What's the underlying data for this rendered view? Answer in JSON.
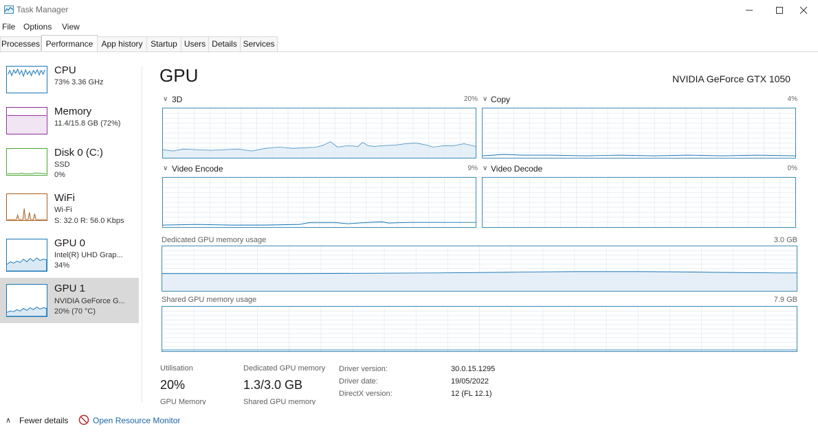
{
  "window": {
    "title": "Task Manager"
  },
  "menu": [
    "File",
    "Options",
    "View"
  ],
  "tabs": [
    "Processes",
    "Performance",
    "App history",
    "Startup",
    "Users",
    "Details",
    "Services"
  ],
  "sidebar": [
    {
      "title": "CPU",
      "sub1": "73%  3.36 GHz",
      "sub2": "",
      "sub3": "",
      "color": "#1775b5"
    },
    {
      "title": "Memory",
      "sub1": "11.4/15.8 GB (72%)",
      "sub2": "",
      "sub3": "",
      "color": "#8a2d95"
    },
    {
      "title": "Disk 0 (C:)",
      "sub1": "SSD",
      "sub2": "0%",
      "sub3": "",
      "color": "#4aa52d"
    },
    {
      "title": "WiFi",
      "sub1": "Wi-Fi",
      "sub2": "S: 32.0  R: 56.0 Kbps",
      "sub3": "",
      "color": "#a85d1c"
    },
    {
      "title": "GPU 0",
      "sub1": "Intel(R) UHD Grap...",
      "sub2": "34%",
      "sub3": "",
      "color": "#1775b5"
    },
    {
      "title": "GPU 1",
      "sub1": "NVIDIA GeForce G...",
      "sub2": "20% (70 °C)",
      "sub3": "",
      "color": "#1775b5"
    }
  ],
  "main": {
    "title": "GPU",
    "model": "NVIDIA GeForce GTX 1050",
    "graphs": [
      {
        "label": "3D",
        "value": "20%"
      },
      {
        "label": "Copy",
        "value": "4%"
      },
      {
        "label": "Video Encode",
        "value": "9%"
      },
      {
        "label": "Video Decode",
        "value": "0%"
      }
    ],
    "dedicated": {
      "label": "Dedicated GPU memory usage",
      "max": "3.0 GB"
    },
    "shared": {
      "label": "Shared GPU memory usage",
      "max": "7.9 GB"
    },
    "stats": {
      "util_label": "Utilisation",
      "util_value": "20%",
      "ded_label": "Dedicated GPU memory",
      "ded_value": "1.3/3.0 GB",
      "gpu_mem_label": "GPU Memory",
      "shared_mem_label": "Shared GPU memory"
    },
    "info": [
      {
        "label": "Driver version:",
        "value": "30.0.15.1295"
      },
      {
        "label": "Driver date:",
        "value": "19/05/2022"
      },
      {
        "label": "DirectX version:",
        "value": "12 (FL 12.1)"
      }
    ]
  },
  "footer": {
    "fewer": "Fewer details",
    "resource_monitor": "Open Resource Monitor"
  },
  "colors": {
    "accent": "#3d89b5",
    "link": "#1b65a8",
    "selected": "#d9d9d9"
  }
}
